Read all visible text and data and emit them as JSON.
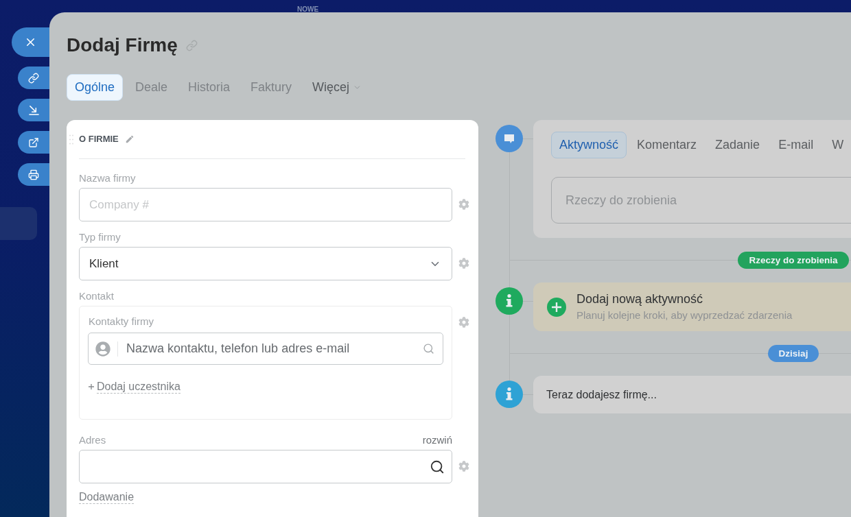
{
  "backdrop": {
    "badge": "NOWE"
  },
  "header": {
    "title": "Dodaj Firmę"
  },
  "tabs": [
    {
      "label": "Ogólne",
      "kind": "tab",
      "selected": true,
      "disabled": false
    },
    {
      "label": "Deale",
      "kind": "tab",
      "selected": false,
      "disabled": true
    },
    {
      "label": "Historia",
      "kind": "tab",
      "selected": false,
      "disabled": true
    },
    {
      "label": "Faktury",
      "kind": "tab",
      "selected": false,
      "disabled": true
    },
    {
      "label": "Więcej",
      "kind": "menu",
      "selected": false,
      "disabled": false
    }
  ],
  "section": {
    "title": "O FIRMIE",
    "fields": [
      {
        "kind": "text",
        "label": "Nazwa firmy",
        "placeholder": "Company #"
      },
      {
        "kind": "select",
        "label": "Typ firmy",
        "value": "Klient"
      },
      {
        "kind": "contacts",
        "label": "Kontakt",
        "sublabel": "Kontakty firmy",
        "placeholder": "Nazwa kontaktu, telefon lub adres e-mail",
        "add_link": "Dodaj uczestnika"
      },
      {
        "kind": "address",
        "label": "Adres",
        "action": "rozwiń"
      }
    ],
    "footer_link": "Dodawanie"
  },
  "timeline": [
    {
      "kind": "composer",
      "tabs": [
        {
          "label": "Aktywność",
          "selected": true
        },
        {
          "label": "Komentarz",
          "selected": false
        },
        {
          "label": "Zadanie",
          "selected": false
        },
        {
          "label": "E-mail",
          "selected": false
        },
        {
          "label": "W",
          "selected": false
        }
      ],
      "placeholder": "Rzeczy do zrobienia"
    },
    {
      "kind": "divider",
      "label": "Rzeczy do zrobienia",
      "color": "#22a35d"
    },
    {
      "kind": "suggestion",
      "title": "Dodaj nową aktywność",
      "subtitle": "Planuj kolejne kroki, aby wyprzedzać zdarzenia"
    },
    {
      "kind": "divider",
      "label": "Dzisiaj",
      "color": "#4a8fd6"
    },
    {
      "kind": "event",
      "text": "Teraz dodajesz firmę..."
    }
  ]
}
